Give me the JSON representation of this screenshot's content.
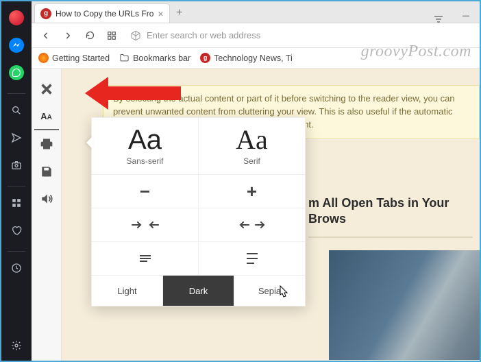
{
  "tab": {
    "title": "How to Copy the URLs Fro"
  },
  "addressbar": {
    "placeholder": "Enter search or web address"
  },
  "bookmarks": {
    "getting_started": "Getting Started",
    "bookmarks_bar": "Bookmarks bar",
    "tech_news": "Technology News, Ti"
  },
  "notice": "By selecting the actual content or part of it before switching to the reader view, you can prevent unwanted content from cluttering your view. This is also useful if the automatic selection module fails to detect the correct content.",
  "headline": "m All Open Tabs in Your Brows",
  "popover": {
    "sans_sample": "Aa",
    "sans_label": "Sans-serif",
    "serif_sample": "Aa",
    "serif_label": "Serif",
    "themes": {
      "light": "Light",
      "dark": "Dark",
      "sepia": "Sepia"
    }
  },
  "watermark": "groovyPost.com"
}
